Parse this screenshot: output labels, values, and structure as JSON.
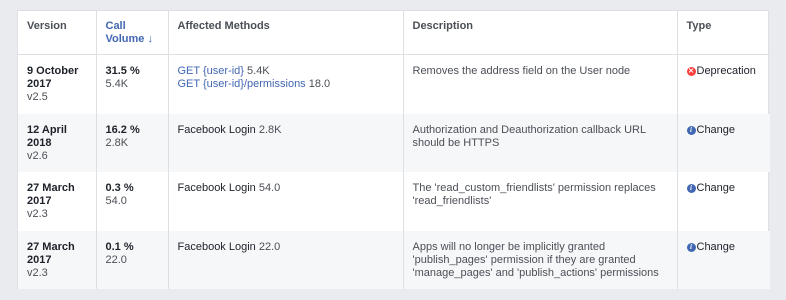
{
  "headers": {
    "version": "Version",
    "call_volume_line1": "Call",
    "call_volume_line2": "Volume ↓",
    "affected_methods": "Affected Methods",
    "description": "Description",
    "type": "Type"
  },
  "rows": [
    {
      "date": "9 October 2017",
      "version": "v2.5",
      "percent": "31.5 %",
      "count": "5.4K",
      "methods": [
        {
          "name": "GET {user-id}",
          "value": "5.4K",
          "link": true
        },
        {
          "name": "GET {user-id}/permissions",
          "value": "18.0",
          "link": true
        }
      ],
      "description": "Removes the address field on the User node",
      "type": "Deprecation",
      "type_icon": "x-circle-icon"
    },
    {
      "date": "12 April 2018",
      "version": "v2.6",
      "percent": "16.2 %",
      "count": "2.8K",
      "methods": [
        {
          "name": "Facebook Login",
          "value": "2.8K",
          "link": false
        }
      ],
      "description": "Authorization and Deauthorization callback URL should be HTTPS",
      "type": "Change",
      "type_icon": "info-icon"
    },
    {
      "date": "27 March 2017",
      "version": "v2.3",
      "percent": "0.3 %",
      "count": "54.0",
      "methods": [
        {
          "name": "Facebook Login",
          "value": "54.0",
          "link": false
        }
      ],
      "description": "The 'read_custom_friendlists' permission replaces 'read_friendlists'",
      "type": "Change",
      "type_icon": "info-icon"
    },
    {
      "date": "27 March 2017",
      "version": "v2.3",
      "percent": "0.1 %",
      "count": "22.0",
      "methods": [
        {
          "name": "Facebook Login",
          "value": "22.0",
          "link": false
        }
      ],
      "description": "Apps will no longer be implicitly granted 'publish_pages' permission if they are granted 'manage_pages' and 'publish_actions' permissions",
      "type": "Change",
      "type_icon": "info-icon"
    }
  ],
  "colors": {
    "link": "#4267b2",
    "deprecation": "#fa3e3e",
    "change": "#4267b2"
  }
}
